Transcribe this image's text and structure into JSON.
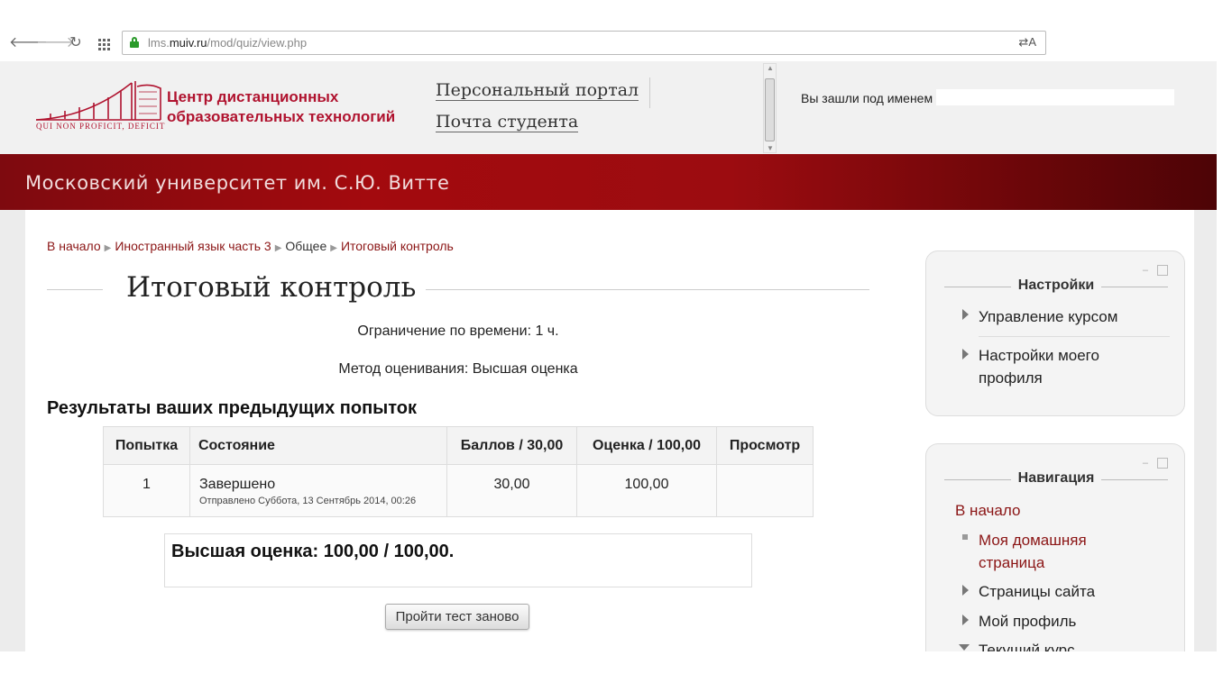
{
  "browser": {
    "url_prefix": "lms.",
    "url_host": "muiv.ru",
    "url_path": "/mod/quiz/view.php",
    "back_glyph": "🡐",
    "forward_glyph": "🡒",
    "reload_glyph": "↻",
    "translate_glyph": "⇄A"
  },
  "header": {
    "logo_line1": "Центр дистанционных",
    "logo_line2": "образовательных технологий",
    "logo_motto": "QUI NON PROFICIT, DEFICIT",
    "portal_link": "Персональный портал",
    "mail_link": "Почта студента",
    "login_text": "Вы зашли под именем",
    "login_name": ""
  },
  "banner": {
    "title": "Московский университет им. С.Ю. Витте"
  },
  "breadcrumb": {
    "home": "В начало",
    "course": "Иностранный язык часть 3",
    "section": "Общее",
    "page": "Итоговый контроль",
    "separator": "▶"
  },
  "quiz": {
    "title": "Итоговый контроль",
    "time_limit": "Ограничение по времени: 1 ч.",
    "grading_method": "Метод оценивания: Высшая оценка",
    "attempts_heading": "Результаты ваших предыдущих попыток",
    "columns": [
      "Попытка",
      "Состояние",
      "Баллов / 30,00",
      "Оценка / 100,00",
      "Просмотр"
    ],
    "rows": [
      {
        "attempt": "1",
        "state": "Завершено",
        "submitted": "Отправлено Суббота, 13 Сентябрь 2014, 00:26",
        "marks": "30,00",
        "grade": "100,00",
        "review": ""
      }
    ],
    "best_grade": "Высшая оценка: 100,00 / 100,00.",
    "reattempt_label": "Пройти тест заново"
  },
  "settings_block": {
    "title": "Настройки",
    "items": [
      "Управление курсом",
      "Настройки моего",
      "профиля"
    ]
  },
  "nav_block": {
    "title": "Навигация",
    "home": "В начало",
    "my_home_line1": "Моя домашняя",
    "my_home_line2": "страница",
    "site_pages": "Страницы сайта",
    "my_profile": "Мой профиль",
    "current_course": "Текущий курс"
  },
  "block_controls": {
    "minimize": "–"
  }
}
